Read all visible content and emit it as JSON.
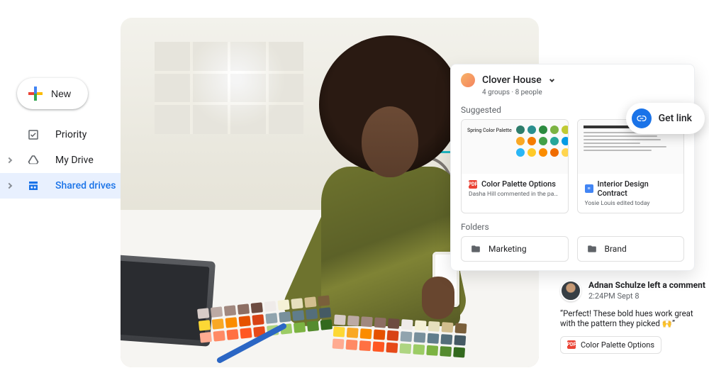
{
  "sidebar": {
    "new_label": "New",
    "items": [
      {
        "label": "Priority"
      },
      {
        "label": "My Drive"
      },
      {
        "label": "Shared drives"
      }
    ]
  },
  "drive_panel": {
    "title": "Clover House",
    "subtitle": "4 groups · 8 people",
    "suggested_label": "Suggested",
    "folders_label": "Folders",
    "files": [
      {
        "name": "Color Palette Options",
        "sub": "Dasha Hill commented in the past month",
        "thumb_label": "Spring Color Palette"
      },
      {
        "name": "Interior Design Contract",
        "sub": "Yosie Louis edited today",
        "thumb_label": "Interior Design Contract"
      }
    ],
    "folders": [
      {
        "name": "Marketing"
      },
      {
        "name": "Brand"
      }
    ]
  },
  "get_link_label": "Get link",
  "comment": {
    "author_line": "Adnan Schulze left a comment",
    "timestamp": "2:24PM Sept 8",
    "body": "“Perfect! These bold hues work great with the pattern they picked 🙌”",
    "file": "Color Palette Options"
  },
  "palette_dots": [
    "#2e7d6b",
    "#2a8f8f",
    "#2b8a3e",
    "#7cb342",
    "#c0ca33",
    "#f9a825",
    "#f57c00",
    "#43a047",
    "#26a69a",
    "#039be5",
    "#29b6f6",
    "#ffca28",
    "#fb8c00",
    "#ef6c00",
    "#ffd54f"
  ],
  "swatch_colors": [
    "#d7ccc8",
    "#bcaaa4",
    "#a1887f",
    "#8d6e63",
    "#6d4c41",
    "#efebe9",
    "#f5f1d6",
    "#e6e0bd",
    "#d2be8e",
    "#7a5f3b",
    "#fdd835",
    "#f9a825",
    "#fb8c00",
    "#e65100",
    "#d84315",
    "#90a4ae",
    "#78909c",
    "#607d8b",
    "#546e7a",
    "#455a64",
    "#ffab91",
    "#ff8a65",
    "#ff7043",
    "#ff5722",
    "#e64a19",
    "#aed581",
    "#9ccc65",
    "#7cb342",
    "#558b2f",
    "#33691e"
  ]
}
